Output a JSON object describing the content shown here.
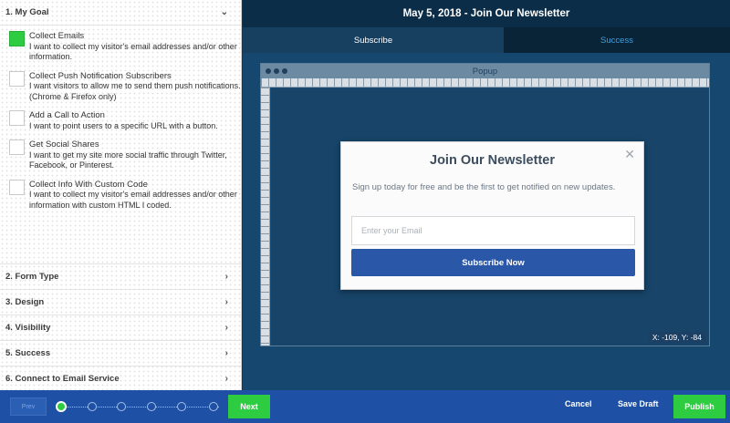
{
  "sidebar": {
    "goal_section": {
      "label": "1. My Goal"
    },
    "goals": [
      {
        "title": "Collect Emails",
        "description": "I want to collect my visitor's email addresses and/or other information.",
        "checked": true
      },
      {
        "title": "Collect Push Notification Subscribers",
        "description": "I want visitors to allow me to send them push notifications. (Chrome & Firefox only)",
        "checked": false
      },
      {
        "title": "Add a Call to Action",
        "description": "I want to point users to a specific URL with a button.",
        "checked": false
      },
      {
        "title": "Get Social Shares",
        "description": "I want to get my site more social traffic through Twitter, Facebook, or Pinterest.",
        "checked": false
      },
      {
        "title": "Collect Info With Custom Code",
        "description": "I want to collect my visitor's email addresses and/or other information with custom HTML I coded.",
        "checked": false
      }
    ],
    "sections": [
      {
        "label": "2. Form Type"
      },
      {
        "label": "3. Design"
      },
      {
        "label": "4. Visibility"
      },
      {
        "label": "5. Success"
      },
      {
        "label": "6. Connect to Email Service"
      }
    ]
  },
  "header": {
    "title": "May 5, 2018 - Join Our Newsletter"
  },
  "tabs": [
    {
      "label": "Subscribe",
      "active": true
    },
    {
      "label": "Success",
      "active": false
    }
  ],
  "editor": {
    "window_title": "Popup",
    "coords": "X: -109, Y: -84"
  },
  "popup": {
    "title": "Join Our Newsletter",
    "description": "Sign up today for free and be the first to get notified on new updates.",
    "email_placeholder": "Enter your Email",
    "button_label": "Subscribe Now",
    "close_symbol": "✕"
  },
  "footer": {
    "preview_label": "Prev",
    "next_label": "Next",
    "cancel_label": "Cancel",
    "save_draft_label": "Save Draft",
    "publish_label": "Publish",
    "steps_total": 6,
    "current_step": 1
  },
  "colors": {
    "accent_green": "#2ecc40",
    "footer_blue": "#1e50a5",
    "subscribe_button": "#2a57a8",
    "success_tab_text": "#3f9fe0"
  }
}
